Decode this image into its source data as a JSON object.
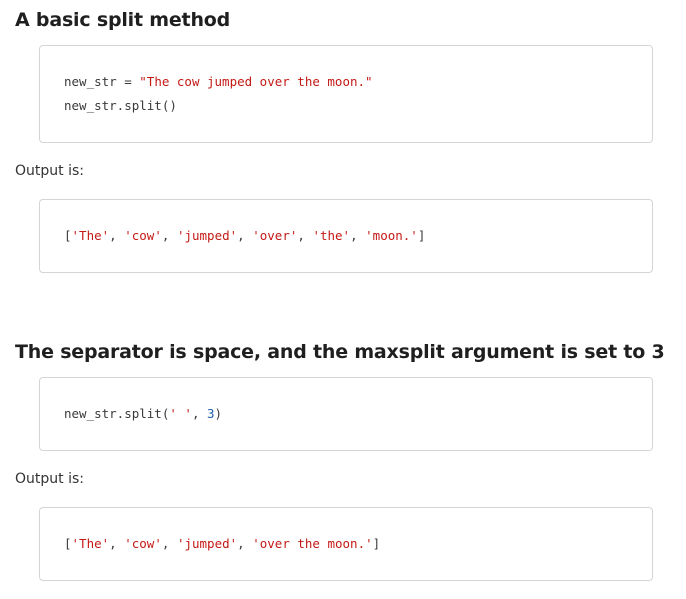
{
  "section1": {
    "heading": "A basic split method",
    "code_line1": {
      "var": "new_str",
      "op": " = ",
      "str": "\"The cow jumped over the moon.\""
    },
    "code_line2": "new_str.split()",
    "output_label": "Output is:",
    "output": {
      "open": "[",
      "items": [
        "'The'",
        "'cow'",
        "'jumped'",
        "'over'",
        "'the'",
        "'moon.'"
      ],
      "sep": ", ",
      "close": "]"
    }
  },
  "section2": {
    "heading": "The separator is space, and the maxsplit argument is set to 3",
    "code": {
      "call": "new_str.split(",
      "arg_str": "' '",
      "sep": ", ",
      "arg_num": "3",
      "close": ")"
    },
    "output_label": "Output is:",
    "output": {
      "open": "[",
      "items": [
        "'The'",
        "'cow'",
        "'jumped'",
        "'over the moon.'"
      ],
      "sep": ", ",
      "close": "]"
    }
  }
}
